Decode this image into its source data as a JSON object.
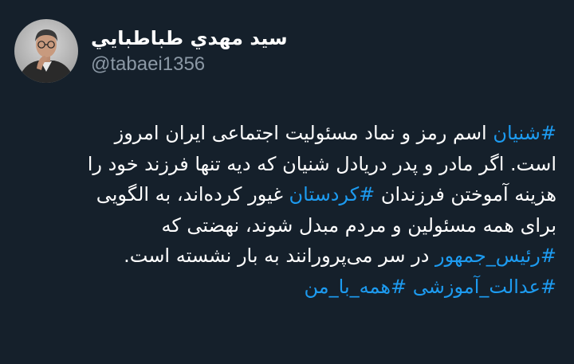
{
  "author": {
    "display_name": "سید مهدي طباطبايي",
    "handle": "@tabaei1356"
  },
  "tweet": {
    "line1": {
      "hashtag": "#شنیان",
      "text": " اسم رمز و نماد مسئولیت اجتماعی ایران امروز"
    },
    "line2": "است. اگر مادر و پدر دریادل شنیان که دیه تنها فرزند خود را",
    "line3": {
      "text_before": "هزینه آموختن فرزندان ",
      "hashtag": "#کردستان",
      "text_after": " غیور کرده‌اند، به الگویی"
    },
    "line4": "برای همه مسئولین و مردم مبدل شوند، نهضتی که",
    "line5": {
      "hashtag": "#رئیس_جمهور",
      "text": " در سر می‌پرورانند به بار نشسته است."
    },
    "line6": {
      "hashtag1": "#عدالت_آموزشی",
      "separator": " ",
      "hashtag2": "#همه_با_من"
    }
  },
  "colors": {
    "background": "#15202b",
    "text": "#ffffff",
    "secondary_text": "#8b98a5",
    "hashtag": "#1d9bf0"
  }
}
